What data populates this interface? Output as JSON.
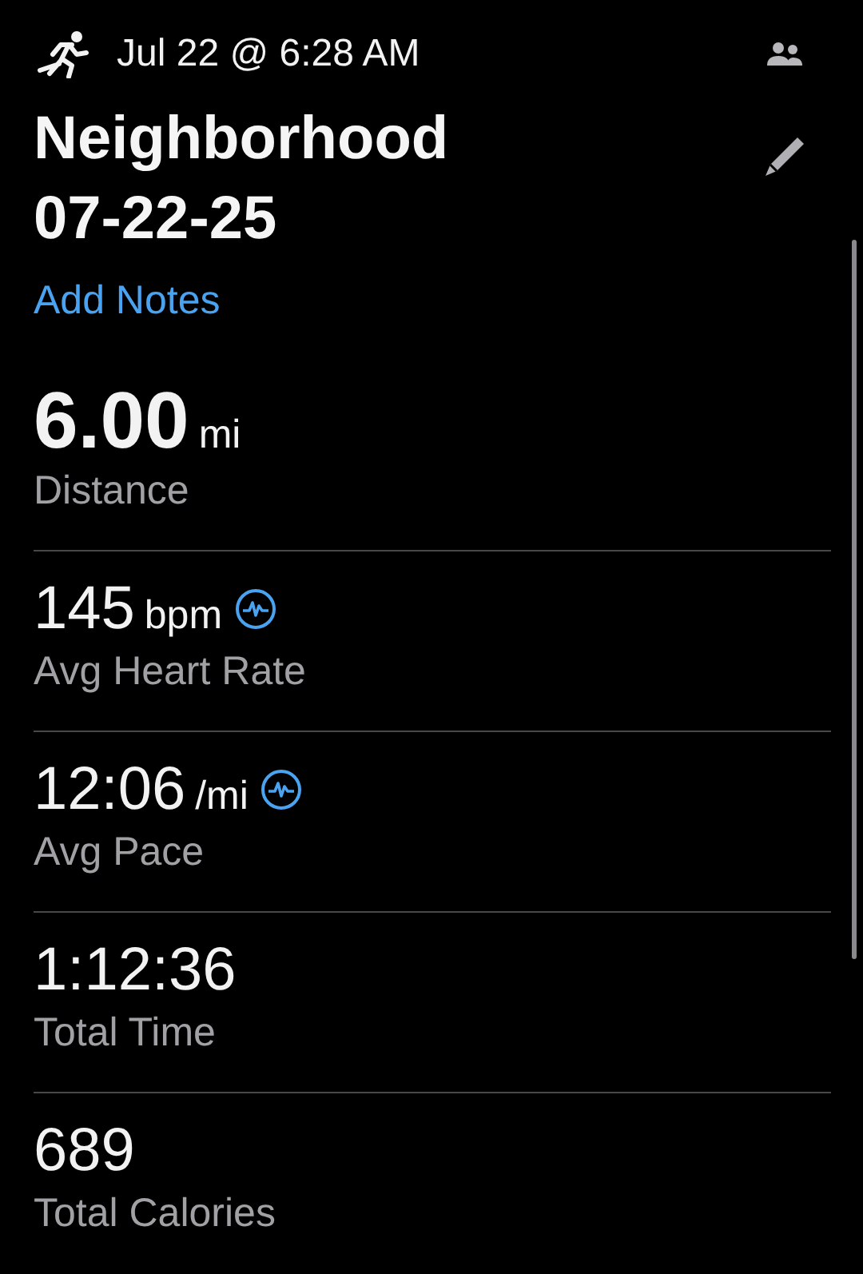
{
  "header": {
    "datetime": "Jul 22 @ 6:28 AM"
  },
  "title": {
    "lines": [
      "Neighborhood",
      "07-22-25"
    ]
  },
  "notes_link": "Add Notes",
  "stats": [
    {
      "kind": "headline",
      "value": "6.00",
      "unit": "mi",
      "label": "Distance",
      "pulse_icon": false
    },
    {
      "kind": "metric",
      "value": "145",
      "unit": "bpm",
      "label": "Avg Heart Rate",
      "pulse_icon": true
    },
    {
      "kind": "metric",
      "value": "12:06",
      "unit": "/mi",
      "label": "Avg Pace",
      "pulse_icon": true
    },
    {
      "kind": "metric",
      "value": "1:12:36",
      "label": "Total Time",
      "pulse_icon": false
    },
    {
      "kind": "metric",
      "value": "689",
      "label": "Total Calories",
      "pulse_icon": false
    }
  ]
}
